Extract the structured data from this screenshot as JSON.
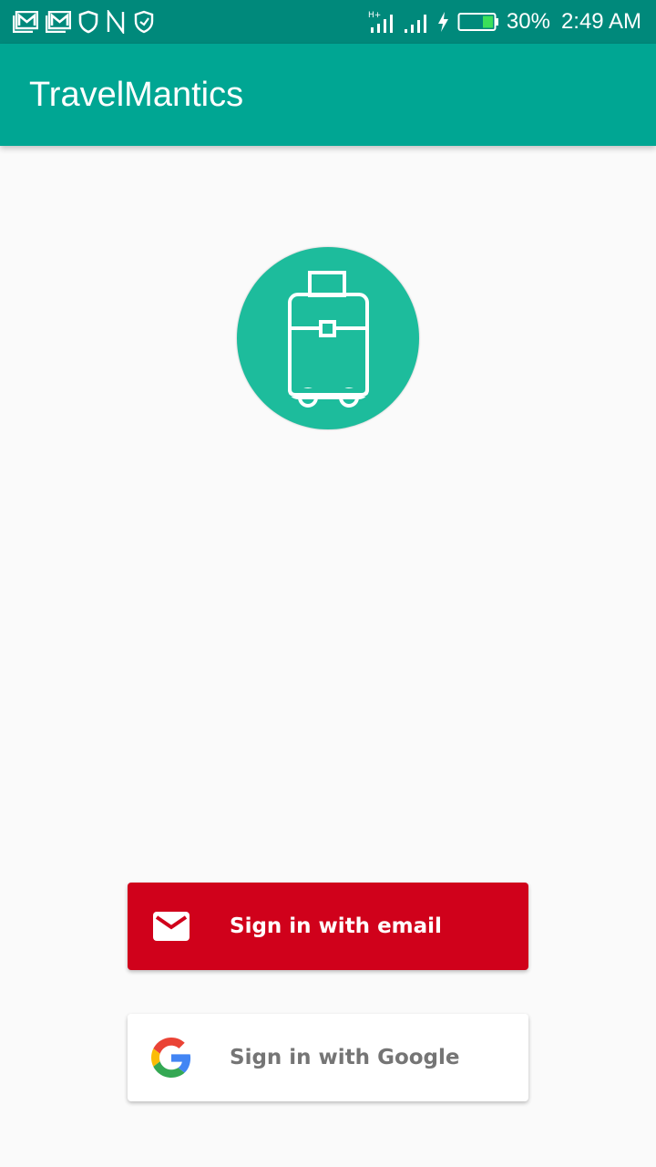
{
  "status_bar": {
    "battery_percent": "30%",
    "time": "2:49 AM",
    "network": "H+",
    "left_icons": [
      "gmail-icon",
      "gmail-icon",
      "shield-icon",
      "n-icon",
      "vpn-shield-icon"
    ],
    "right_icons": [
      "signal-icon",
      "signal-icon",
      "charging-icon",
      "battery-icon"
    ]
  },
  "app_bar": {
    "title": "TravelMantics"
  },
  "logo": {
    "icon": "suitcase-icon",
    "color": "#1dbc9c"
  },
  "auth": {
    "email_button": {
      "label": "Sign in with email",
      "icon": "mail-icon",
      "color": "#d0011b"
    },
    "google_button": {
      "label": "Sign in with Google",
      "icon": "google-icon",
      "color": "#ffffff"
    }
  },
  "colors": {
    "primary": "#00a693",
    "primary_dark": "#00897b",
    "background": "#fafafa"
  }
}
